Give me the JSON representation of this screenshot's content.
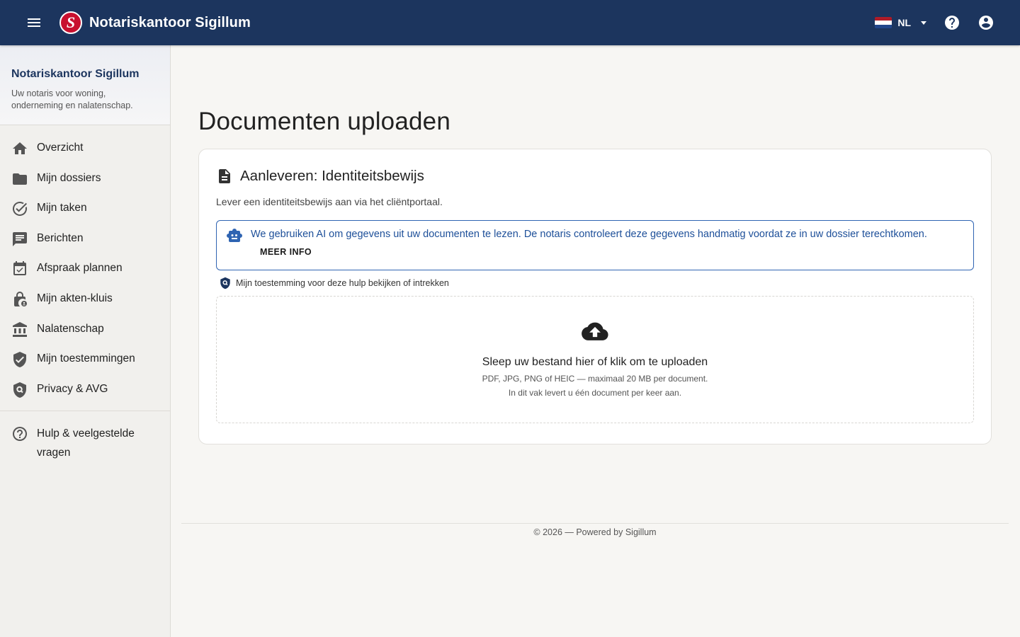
{
  "app": {
    "brand": "Notariskantoor Sigillum",
    "logo_letter": "S",
    "language": "NL"
  },
  "colors": {
    "topbar": "#1c355e",
    "accent": "#2f64b2",
    "logo": "#c8102e"
  },
  "sidebar": {
    "title": "Notariskantoor Sigillum",
    "subtitle": "Uw notaris voor woning, onderneming en nalatenschap.",
    "items": [
      {
        "label": "Overzicht",
        "icon": "home-icon"
      },
      {
        "label": "Mijn dossiers",
        "icon": "folder-icon"
      },
      {
        "label": "Mijn taken",
        "icon": "check-circle-icon"
      },
      {
        "label": "Berichten",
        "icon": "message-icon"
      },
      {
        "label": "Afspraak plannen",
        "icon": "calendar-check-icon"
      },
      {
        "label": "Mijn akten-kluis",
        "icon": "lock-person-icon"
      },
      {
        "label": "Nalatenschap",
        "icon": "bank-icon"
      },
      {
        "label": "Mijn toestemmingen",
        "icon": "shield-check-icon"
      },
      {
        "label": "Privacy & AVG",
        "icon": "shield-search-icon"
      }
    ],
    "help": {
      "label": "Hulp & veelgestelde vragen",
      "icon": "help-circle-icon"
    }
  },
  "main": {
    "page_title": "Documenten uploaden",
    "card": {
      "title": "Aanleveren: Identiteitsbewijs",
      "description": "Lever een identiteitsbewijs aan via het cliëntportaal.",
      "ai_notice": "We gebruiken AI om gegevens uit uw documenten te lezen. De notaris controleert deze gegevens handmatig voordat ze in uw dossier terechtkomen.",
      "ai_more": "MEER INFO",
      "consent_link": "Mijn toestemming voor deze hulp bekijken of intrekken",
      "dropzone": {
        "title": "Sleep uw bestand hier of klik om te uploaden",
        "formats": "PDF, JPG, PNG of HEIC — maximaal 20 MB per document.",
        "note": "In dit vak levert u één document per keer aan."
      }
    }
  },
  "footer": {
    "text": "© 2026 — Powered by Sigillum"
  }
}
